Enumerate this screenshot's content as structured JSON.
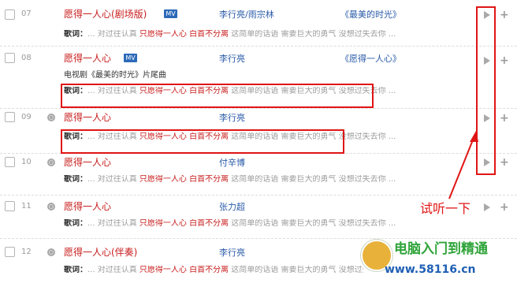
{
  "songs": [
    {
      "num": "07",
      "title": "愿得一人心(剧场版)",
      "has_mv": true,
      "mv_label": "MV",
      "artist": "李行亮/雨宗林",
      "album": "《最美的时光》",
      "subtitle": "",
      "lyrics_key": "歌词：",
      "lyrics_pre": "... 对过往认真 ",
      "lyrics_hl": "只愿得一人心 白首不分离",
      "lyrics_post": " 这简单的话语 需要巨大的勇气 没想过失去你 ..."
    },
    {
      "num": "08",
      "title": "愿得一人心",
      "has_mv": true,
      "mv_label": "MV",
      "artist": "李行亮",
      "album": "《愿得一人心》",
      "subtitle": "电视剧《最美的时光》片尾曲",
      "lyrics_key": "歌词：",
      "lyrics_pre": "... 对过往认真 ",
      "lyrics_hl": "只愿得一人心 白首不分离",
      "lyrics_post": " 这简单的话语 需要巨大的勇气 没想过失去你 ..."
    },
    {
      "num": "09",
      "title": "愿得一人心",
      "has_mv": false,
      "mv_label": "",
      "artist": "李行亮",
      "album": "",
      "subtitle": "",
      "lyrics_key": "歌词：",
      "lyrics_pre": "... 对过往认真 ",
      "lyrics_hl": "只愿得一人心 白首不分离",
      "lyrics_post": " 这简单的话语 需要巨大的勇气 没想过失去你 ..."
    },
    {
      "num": "10",
      "title": "愿得一人心",
      "has_mv": false,
      "mv_label": "",
      "artist": "付辛博",
      "album": "",
      "subtitle": "",
      "lyrics_key": "歌词：",
      "lyrics_pre": "... 对过往认真 ",
      "lyrics_hl": "只愿得一人心 白首不分离",
      "lyrics_post": " 这简单的话语 需要巨大的勇气 没想过失去你 ..."
    },
    {
      "num": "11",
      "title": "愿得一人心",
      "has_mv": false,
      "mv_label": "",
      "artist": "张力超",
      "album": "",
      "subtitle": "",
      "lyrics_key": "歌词：",
      "lyrics_pre": "... 对过往认真 ",
      "lyrics_hl": "只愿得一人心 白首不分离",
      "lyrics_post": " 这简单的话语 需要巨大的勇气 没想过失去你 ..."
    },
    {
      "num": "12",
      "title": "愿得一人心(伴奏)",
      "has_mv": false,
      "mv_label": "",
      "artist": "李行亮",
      "album": "",
      "subtitle": "",
      "lyrics_key": "歌词：",
      "lyrics_pre": "... 对过往认真 ",
      "lyrics_hl": "只愿得一人心 白首不分离",
      "lyrics_post": " 这简单的话语 需要巨大的勇气 没想过失去你 ..."
    }
  ],
  "annotation": "试听一下",
  "watermark": {
    "line1": "电脑入门到精通",
    "line2": "www.58116.cn"
  },
  "colors": {
    "title": "#c81c1c",
    "link": "#2a5ba8",
    "highlight_box": "#e01515"
  }
}
